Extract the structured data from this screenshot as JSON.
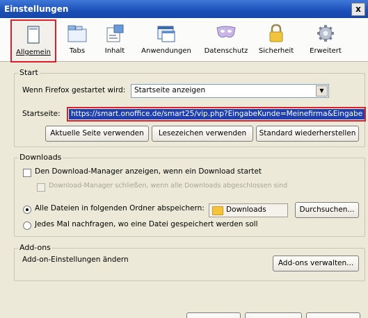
{
  "window": {
    "title": "Einstellungen",
    "close_label": "x"
  },
  "panes": [
    {
      "label": "Allgemein",
      "icon": "window-icon",
      "selected": true
    },
    {
      "label": "Tabs",
      "icon": "tabs-icon"
    },
    {
      "label": "Inhalt",
      "icon": "content-icon"
    },
    {
      "label": "Anwendungen",
      "icon": "applications-icon"
    },
    {
      "label": "Datenschutz",
      "icon": "mask-icon"
    },
    {
      "label": "Sicherheit",
      "icon": "padlock-icon"
    },
    {
      "label": "Erweitert",
      "icon": "gear-icon"
    }
  ],
  "start": {
    "title": "Start",
    "startup_label": "Wenn Firefox gestartet wird:",
    "startup_value": "Startseite anzeigen",
    "homepage_label": "Startseite:",
    "homepage_value": "https://smart.onoffice.de/smart25/vip.php?EingabeKunde=Meinefirma&Eingabe",
    "use_current_btn": "Aktuelle Seite verwenden",
    "use_bookmark_btn": "Lesezeichen verwenden",
    "restore_default_btn": "Standard wiederherstellen"
  },
  "downloads": {
    "title": "Downloads",
    "show_manager": "Den Download-Manager anzeigen, wenn ein Download startet",
    "close_manager": "Download-Manager schließen, wenn alle Downloads abgeschlossen sind",
    "save_all": "Alle Dateien in folgenden Ordner abspeichern:",
    "folder_value": "Downloads",
    "browse_btn": "Durchsuchen...",
    "always_ask": "Jedes Mal nachfragen, wo eine Datei gespeichert werden soll"
  },
  "addons": {
    "title": "Add-ons",
    "change_label": "Add-on-Einstellungen ändern",
    "manage_btn": "Add-ons verwalten..."
  },
  "colors": {
    "highlight": "#e21b2a",
    "selection": "#1e3fae",
    "titlebar": "#1b4fb8"
  }
}
